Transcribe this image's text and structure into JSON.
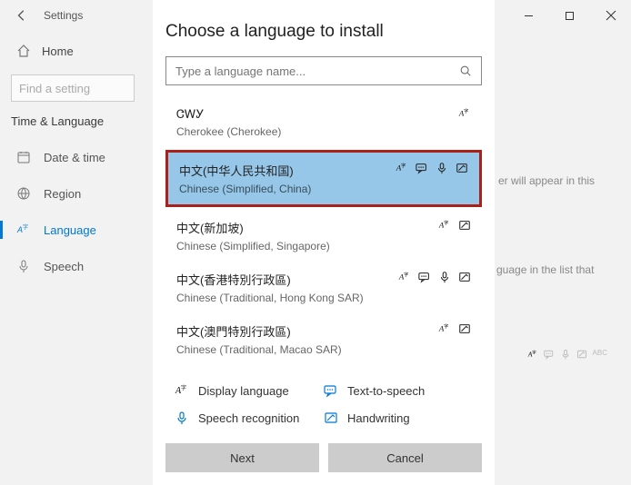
{
  "titlebar": {
    "app_name": "Settings"
  },
  "sidebar": {
    "home_label": "Home",
    "find_placeholder": "Find a setting",
    "section": "Time & Language",
    "items": [
      {
        "label": "Date & time"
      },
      {
        "label": "Region"
      },
      {
        "label": "Language"
      },
      {
        "label": "Speech"
      }
    ]
  },
  "background": {
    "line1": "er will appear in this",
    "line2": "guage in the list that"
  },
  "dialog": {
    "title": "Choose a language to install",
    "search_placeholder": "Type a language name...",
    "languages": [
      {
        "native": "ᏣᎳᎩ",
        "english": "Cherokee (Cherokee)",
        "features": [
          "display"
        ]
      },
      {
        "native": "中文(中华人民共和国)",
        "english": "Chinese (Simplified, China)",
        "features": [
          "display",
          "tts",
          "speech",
          "hand"
        ],
        "highlighted": true
      },
      {
        "native": "中文(新加坡)",
        "english": "Chinese (Simplified, Singapore)",
        "features": [
          "display",
          "hand"
        ]
      },
      {
        "native": "中文(香港特別行政區)",
        "english": "Chinese (Traditional, Hong Kong SAR)",
        "features": [
          "display",
          "tts",
          "speech",
          "hand"
        ]
      },
      {
        "native": "中文(澳門特別行政區)",
        "english": "Chinese (Traditional, Macao SAR)",
        "features": [
          "display",
          "hand"
        ]
      }
    ],
    "legend": {
      "display": "Display language",
      "tts": "Text-to-speech",
      "speech": "Speech recognition",
      "hand": "Handwriting"
    },
    "buttons": {
      "next": "Next",
      "cancel": "Cancel"
    }
  }
}
